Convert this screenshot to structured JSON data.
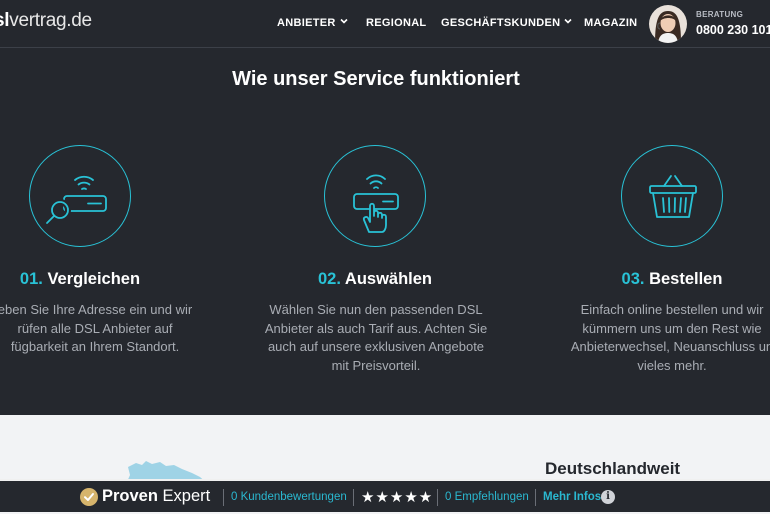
{
  "header": {
    "logo_bold": "sl",
    "logo_light": "vertrag.de",
    "nav": [
      {
        "label": "ANBIETER",
        "has_dropdown": true
      },
      {
        "label": "REGIONAL",
        "has_dropdown": false
      },
      {
        "label": "GESCHÄFTSKUNDEN",
        "has_dropdown": true
      },
      {
        "label": "MAGAZIN",
        "has_dropdown": false
      }
    ],
    "hotline_label": "BERATUNG",
    "hotline_number": "0800 230 101"
  },
  "service": {
    "title": "Wie unser Service funktioniert",
    "steps": [
      {
        "number": "01.",
        "title": "Vergleichen",
        "icon": "router-search-icon",
        "lines": [
          "eben Sie Ihre Adresse ein und wir",
          "rüfen alle DSL Anbieter auf",
          "fügbarkeit an Ihrem Standort."
        ]
      },
      {
        "number": "02.",
        "title": "Auswählen",
        "icon": "router-select-icon",
        "lines": [
          "Wählen Sie nun den passenden DSL",
          "Anbieter als auch Tarif aus. Achten Sie",
          "auch auf unsere exklusiven Angebote",
          "mit Preisvorteil."
        ]
      },
      {
        "number": "03.",
        "title": "Bestellen",
        "icon": "basket-icon",
        "lines": [
          "Einfach online bestellen und wir",
          "kümmern uns um den Rest wie",
          "Anbieterwechsel, Neuanschluss un",
          "vieles mehr."
        ]
      }
    ]
  },
  "lower": {
    "title": "Deutschlandweit"
  },
  "proven_expert": {
    "brand_bold": "Proven",
    "brand_light": "Expert",
    "reviews": "0 Kundenbewertungen",
    "stars": "★★★★★",
    "recommendations": "0 Empfehlungen",
    "more_info": "Mehr Infos",
    "info_glyph": "i"
  },
  "colors": {
    "background": "#25282e",
    "accent": "#29c2d6",
    "muted_text": "#a9adb4",
    "light_section": "#f2f3f5"
  }
}
